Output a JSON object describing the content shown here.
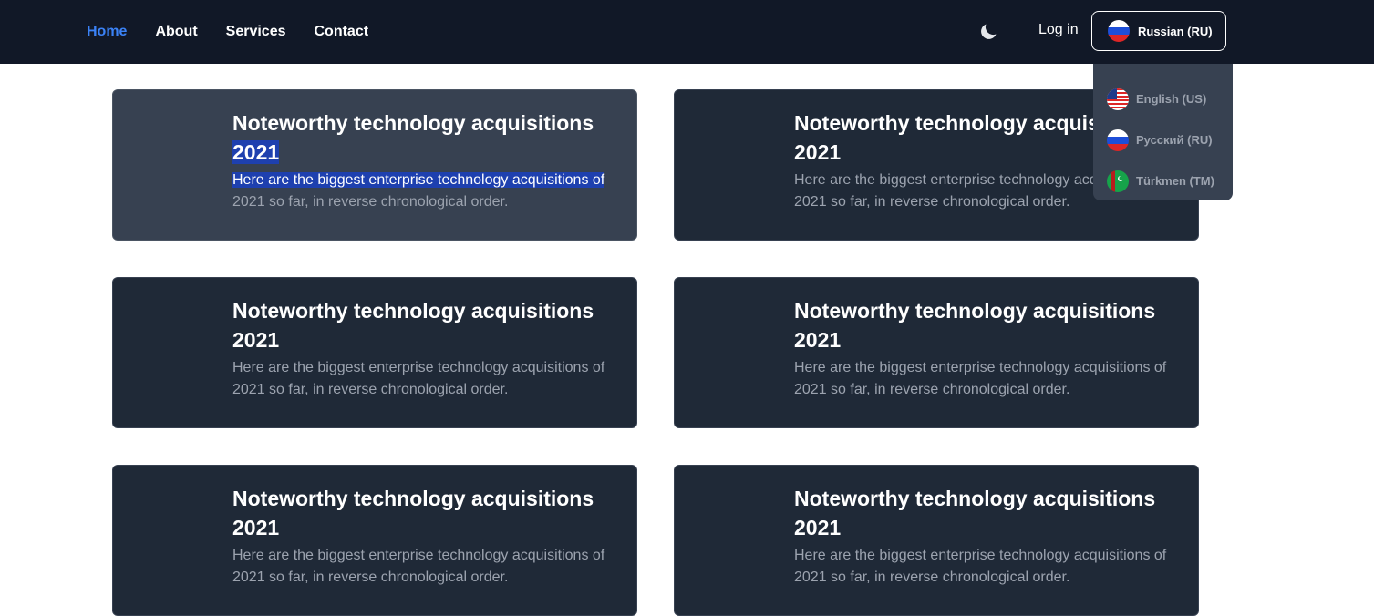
{
  "nav": {
    "links": [
      {
        "label": "Home",
        "active": true
      },
      {
        "label": "About",
        "active": false
      },
      {
        "label": "Services",
        "active": false
      },
      {
        "label": "Contact",
        "active": false
      }
    ],
    "theme_icon": "moon-icon",
    "login_label": "Log in",
    "language_button_label": "Russian (RU)"
  },
  "language_menu": {
    "items": [
      {
        "label": "English (US)",
        "icon": "us-flag-icon"
      },
      {
        "label": "Русский (RU)",
        "icon": "ru-flag-icon"
      },
      {
        "label": "Türkmen (TM)",
        "icon": "tm-flag-icon"
      }
    ]
  },
  "cards": [
    {
      "title": "Noteworthy technology acquisitions 2021",
      "title_part1": "Noteworthy technology acquisitions",
      "title_part2": "2021",
      "desc_part1": "Here are the biggest enterprise technology acquisitions of",
      "desc_part2": "2021 so far, in reverse chronological order.",
      "hovered": true,
      "text_selected": true
    },
    {
      "title": "Noteworthy technology acquisitions 2021",
      "title_part1": "Noteworthy technology acquisitions",
      "title_part2": "2021",
      "desc_part1": "Here are the biggest enterprise technology acquisitions of",
      "desc_part2": "2021 so far, in reverse chronological order."
    },
    {
      "title": "Noteworthy technology acquisitions 2021",
      "title_part1": "Noteworthy technology acquisitions",
      "title_part2": "2021",
      "desc_part1": "Here are the biggest enterprise technology acquisitions of",
      "desc_part2": "2021 so far, in reverse chronological order."
    },
    {
      "title": "Noteworthy technology acquisitions 2021",
      "title_part1": "Noteworthy technology acquisitions",
      "title_part2": "2021",
      "desc_part1": "Here are the biggest enterprise technology acquisitions of",
      "desc_part2": "2021 so far, in reverse chronological order."
    },
    {
      "title": "Noteworthy technology acquisitions 2021",
      "title_part1": "Noteworthy technology acquisitions",
      "title_part2": "2021",
      "desc_part1": "Here are the biggest enterprise technology acquisitions of",
      "desc_part2": "2021 so far, in reverse chronological order."
    },
    {
      "title": "Noteworthy technology acquisitions 2021",
      "title_part1": "Noteworthy technology acquisitions",
      "title_part2": "2021",
      "desc_part1": "Here are the biggest enterprise technology acquisitions of",
      "desc_part2": "2021 so far, in reverse chronological order."
    }
  ],
  "colors": {
    "navbar_bg": "#111827",
    "active_link": "#3b82f6",
    "card_bg": "#1f2937",
    "card_hover_bg": "#374151",
    "selection": "#1e40af"
  }
}
